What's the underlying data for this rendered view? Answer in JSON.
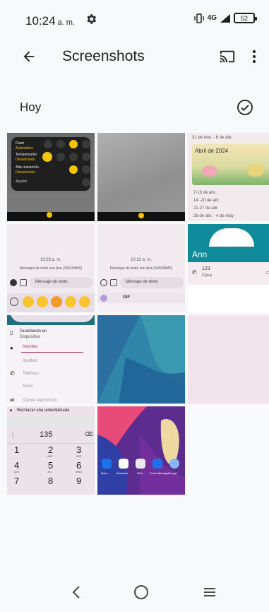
{
  "status": {
    "time": "10:24",
    "ampm": "a. m.",
    "network": "4G",
    "battery": "52"
  },
  "app_bar": {
    "title": "Screenshots"
  },
  "section": {
    "title": "Hoy"
  },
  "thumbs": {
    "t1": {
      "lines": [
        "Flash",
        "Automático",
        "Temporizador",
        "Desactivado",
        "Alta resolución",
        "Desactivado",
        "Ajustes"
      ]
    },
    "t3": {
      "date_head": "31 de mar. - 6 de abr.",
      "month": "Abril de 2024",
      "weeks": [
        "7-13 de abr.",
        "14 -20 de abr.",
        "21-27 de abr.",
        "28 de abr. - 4 de may"
      ]
    },
    "t4": {
      "time": "10:23 a. m.",
      "msg": "Mensajes de texto con Ana (SMS/MMS)",
      "input": "Mensaje de texto"
    },
    "t5": {
      "time": "10:23 a. m.",
      "msg": "Mensajes de texto con Ana (SMS/MMS)",
      "input": "Mensaje de texto",
      "gif": "GIF"
    },
    "t6": {
      "name": "Ann",
      "number": "123",
      "type": "Casa"
    },
    "t7": {
      "saving": "Guardando en",
      "dest": "Dispositivo",
      "fields": [
        "Nombre",
        "Apellido",
        "Teléfono",
        "Móvil",
        "Correo electrónico"
      ]
    },
    "t10": {
      "reject": "Rechazar una videollamada",
      "number": "135",
      "keys": [
        "1",
        "2",
        "3",
        "4",
        "5",
        "6",
        "7",
        "8",
        "9"
      ],
      "sub": [
        "",
        "ABC",
        "DEF",
        "GHI",
        "JKL",
        "MNO",
        "",
        "",
        ""
      ]
    },
    "t11": {
      "apps": [
        "Meet",
        "Asistente",
        "Files",
        "Smart Manager",
        "Google"
      ]
    }
  },
  "colors": {
    "accent": "#0b57d0",
    "teal": "#0f8a9b"
  }
}
